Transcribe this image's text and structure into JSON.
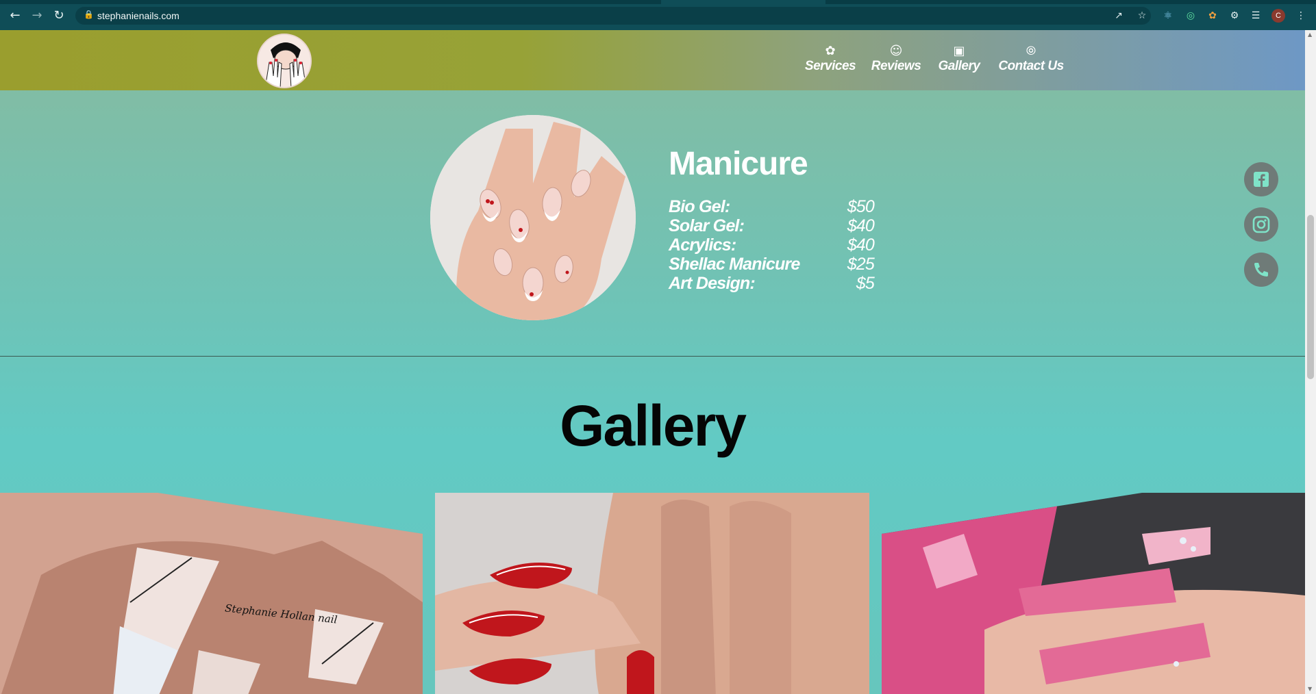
{
  "browser": {
    "url": "stephanienails.com",
    "avatar_letter": "C",
    "back_icon": "arrow-left-icon",
    "forward_icon": "arrow-right-icon",
    "reload_icon": "reload-icon",
    "lock_icon": "lock-icon"
  },
  "header": {
    "nav": [
      {
        "label": "Services",
        "icon": "flower-icon"
      },
      {
        "label": "Reviews",
        "icon": "smiley-icon"
      },
      {
        "label": "Gallery",
        "icon": "images-icon"
      },
      {
        "label": "Contact Us",
        "icon": "signal-icon"
      }
    ],
    "gradient_left": "#9a9e2e",
    "gradient_right": "#6e98c5"
  },
  "service": {
    "title": "Manicure",
    "prices": [
      {
        "name": "Bio Gel:",
        "price": "$50"
      },
      {
        "name": "Solar Gel:",
        "price": "$40"
      },
      {
        "name": "Acrylics:",
        "price": "$40"
      },
      {
        "name": "Shellac Manicure",
        "price": "$25"
      },
      {
        "name": "Art Design:",
        "price": "$5"
      }
    ]
  },
  "social": [
    {
      "icon": "facebook-icon"
    },
    {
      "icon": "instagram-icon"
    },
    {
      "icon": "phone-icon"
    }
  ],
  "gallery": {
    "title": "Gallery",
    "watermark": "Stephanie Hollan nail"
  },
  "colors": {
    "accent_teal": "#62cac4",
    "nail_red": "#c0161c",
    "icon_mint": "#7fe3c8"
  }
}
